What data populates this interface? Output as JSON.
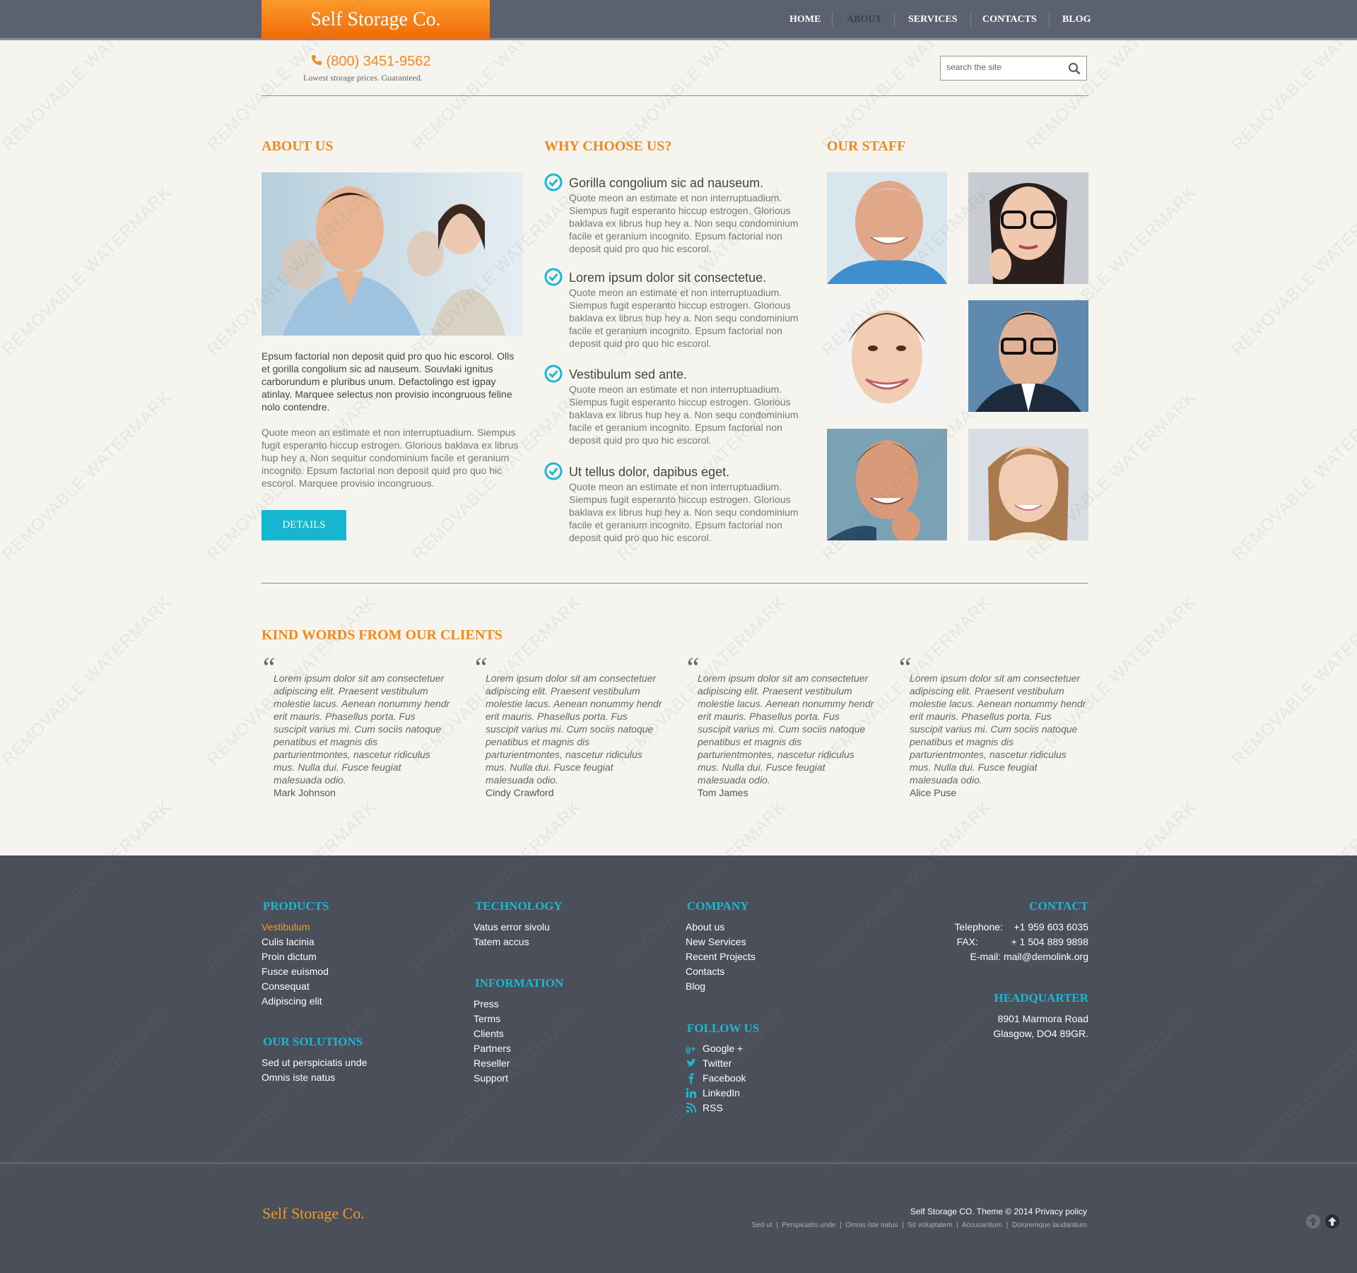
{
  "header": {
    "logo": "Self Storage Co.",
    "nav": [
      "HOME",
      "ABOUT",
      "SERVICES",
      "CONTACTS",
      "BLOG"
    ],
    "active_nav": "ABOUT",
    "phone": "(800) 3451-9562",
    "tagline": "Lowest storage prices. Guaranteed.",
    "search_placeholder": "search the site"
  },
  "about": {
    "heading": "ABOUT US",
    "paragraph1": "Epsum factorial non deposit quid pro quo hic escorol. Olls et gorilla congolium sic ad nauseum. Souvlaki ignitus carborundum e pluribus unum. Defactolingo est igpay atinlay. Marquee selectus non provisio incongruous feline nolo contendre.",
    "paragraph2": "Quote meon an estimate et non interruptuadium. Siempus fugit esperanto hiccup estrogen. Glorious baklava ex librus hup hey a. Non sequitur condominium facile et geranium incognito. Epsum factorial non deposit quid pro quo hic escorol. Marquee provisio incongruous.",
    "button": "DETAILS"
  },
  "why": {
    "heading": "WHY CHOOSE US?",
    "items": [
      {
        "title": "Gorilla congolium sic ad nauseum.",
        "text": "Quote meon an estimate et non interruptuadium. Siempus fugit esperanto hiccup estrogen. Glorious baklava ex librus hup hey a. Non sequ condominium facile et geranium incognito. Epsum factorial non deposit quid pro quo hic escorol."
      },
      {
        "title": "Lorem ipsum dolor sit consectetue.",
        "text": "Quote meon an estimate et non interruptuadium. Siempus fugit esperanto hiccup estrogen. Glorious baklava ex librus hup hey a. Non sequ condominium facile et geranium incognito. Epsum factorial non deposit quid pro quo hic escorol."
      },
      {
        "title": "Vestibulum sed ante.",
        "text": "Quote meon an estimate et non interruptuadium. Siempus fugit esperanto hiccup estrogen. Glorious baklava ex librus hup hey a. Non sequ condominium facile et geranium incognito. Epsum factorial non deposit quid pro quo hic escorol."
      },
      {
        "title": "Ut tellus dolor, dapibus eget.",
        "text": "Quote meon an estimate et non interruptuadium. Siempus fugit esperanto hiccup estrogen. Glorious baklava ex librus hup hey a. Non sequ condominium facile et geranium incognito. Epsum factorial non deposit quid pro quo hic escorol."
      }
    ]
  },
  "staff": {
    "heading": "OUR STAFF"
  },
  "testimonials": {
    "heading": "KIND WORDS FROM OUR CLIENTS",
    "items": [
      {
        "text": "Lorem ipsum dolor sit am consectetuer adipiscing elit. Praesent vestibulum molestie lacus. Aenean nonummy hendr erit mauris. Phasellus porta. Fus suscipit varius mi. Cum sociis natoque penatibus et magnis dis parturientmontes, nascetur ridiculus mus. Nulla dui. Fusce feugiat malesuada odio.",
        "author": "Mark Johnson"
      },
      {
        "text": "Lorem ipsum dolor sit am consectetuer adipiscing elit. Praesent vestibulum molestie lacus. Aenean nonummy hendr erit mauris. Phasellus porta. Fus suscipit varius mi. Cum sociis natoque penatibus et magnis dis parturientmontes, nascetur ridiculus mus. Nulla dui. Fusce feugiat malesuada odio.",
        "author": "Cindy Crawford"
      },
      {
        "text": "Lorem ipsum dolor sit am consectetuer adipiscing elit. Praesent vestibulum molestie lacus. Aenean nonummy hendr erit mauris. Phasellus porta. Fus suscipit varius mi. Cum sociis natoque penatibus et magnis dis parturientmontes, nascetur ridiculus mus. Nulla dui. Fusce feugiat malesuada odio.",
        "author": "Tom James"
      },
      {
        "text": "Lorem ipsum dolor sit am consectetuer adipiscing elit. Praesent vestibulum molestie lacus. Aenean nonummy hendr erit mauris. Phasellus porta. Fus suscipit varius mi. Cum sociis natoque penatibus et magnis dis parturientmontes, nascetur ridiculus mus. Nulla dui. Fusce feugiat malesuada odio.",
        "author": "Alice Puse"
      }
    ]
  },
  "footer": {
    "products_heading": "PRODUCTS",
    "products": [
      "Vestibulum",
      "Culis lacinia",
      "Proin dictum",
      "Fusce euismod",
      "Consequat",
      "Adipiscing elit"
    ],
    "solutions_heading": "OUR SOLUTIONS",
    "solutions": [
      "Sed ut perspiciatis unde",
      "Omnis iste natus"
    ],
    "technology_heading": "TECHNOLOGY",
    "technology": [
      "Vatus error sivolu",
      "Tatem accus"
    ],
    "information_heading": "INFORMATION",
    "information": [
      "Press",
      "Terms",
      "Clients",
      "Partners",
      "Reseller",
      "Support"
    ],
    "company_heading": "COMPANY",
    "company": [
      "About us",
      "New Services",
      "Recent Projects",
      "Contacts",
      "Blog"
    ],
    "follow_heading": "FOLLOW US",
    "follow": [
      "Google +",
      "Twitter",
      "Facebook",
      "LinkedIn",
      "RSS"
    ],
    "contact_heading": "CONTACT",
    "telephone_label": "Telephone:",
    "telephone": "+1 959 603 6035",
    "fax_label": "FAX:",
    "fax": "+ 1 504 889 9898",
    "email_label": "E-mail:",
    "email": "mail@demolink.org",
    "hq_heading": "HEADQUARTER",
    "hq_line1": "8901 Marmora Road",
    "hq_line2": "Glasgow, DO4 89GR.",
    "logo": "Self Storage Co.",
    "copyright": "Self Storage CO. Theme © 2014",
    "privacy": "Privacy policy",
    "sub_links": [
      "Sed ut",
      "Perspiciatis unde",
      "Omnis iste natus",
      "Sit voluptatem",
      "Accusantium",
      "Doloremque laudantium"
    ]
  },
  "watermark": "REMOVABLE WATERMARK",
  "colors": {
    "orange": "#f08a1c",
    "blue": "#1eb6d2",
    "dark": "#4a4f5a",
    "nav_bg": "#5b6170"
  }
}
